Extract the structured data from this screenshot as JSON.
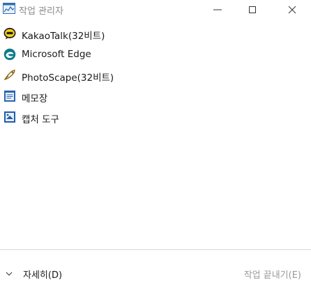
{
  "window": {
    "title": "작업 관리자",
    "icons": {
      "app": "task-manager-icon",
      "minimize": "minimize-icon",
      "maximize": "maximize-icon",
      "close": "close-icon"
    }
  },
  "processes": [
    {
      "label": "KakaoTalk(32비트)",
      "icon": "kakaotalk-icon"
    },
    {
      "label": "Microsoft Edge",
      "icon": "edge-icon"
    },
    {
      "label": "PhotoScape(32비트)",
      "icon": "photoscape-icon"
    },
    {
      "label": "메모장",
      "icon": "notepad-icon"
    },
    {
      "label": "캡처 도구",
      "icon": "snipping-tool-icon"
    }
  ],
  "footer": {
    "details_label": "자세히(D)",
    "end_task_label": "작업 끝내기(E)"
  },
  "colors": {
    "accent": "#0b5fb0",
    "kakao": "#f7d617",
    "edge": "#0f7b8a",
    "disabled_text": "#9a9a9a"
  }
}
